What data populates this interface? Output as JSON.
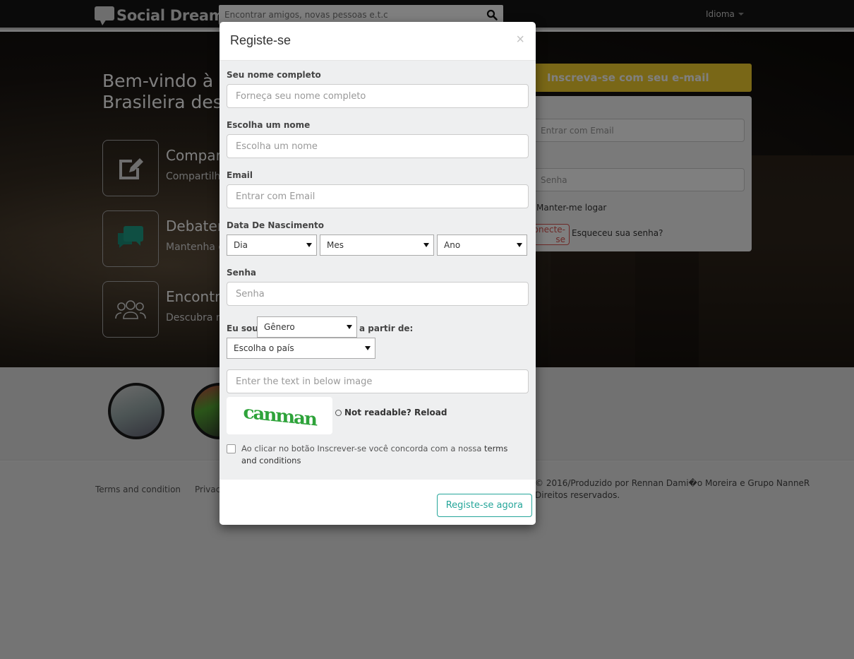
{
  "navbar": {
    "brand": "Social Dream",
    "search_placeholder": "Encontrar amigos, novas pessoas e.t.c",
    "language_label": "Idioma"
  },
  "hero": {
    "title_line1": "Bem-vindo à r",
    "title_line2": "Brasileira dese",
    "features": [
      {
        "icon": "edit-icon",
        "title": "Compart",
        "desc": "Compartilhe"
      },
      {
        "icon": "chat-bubbles-icon",
        "title": "Debater",
        "desc": "Mantenha c"
      },
      {
        "icon": "users-icon",
        "title": "Encontre",
        "desc": "Descubra no"
      }
    ]
  },
  "login": {
    "header": "Inscreva-se com seu e-mail",
    "email_placeholder": "Entrar com Email",
    "password_placeholder": "Senha",
    "remember_label": "Manter-me logar",
    "login_button": "Conecte-se",
    "forgot_link": "Esqueceu sua senha?"
  },
  "footer": {
    "links": [
      "Terms and condition",
      "Privacy"
    ],
    "copyright_line1": "© 2016/Produzido por Rennan Dami�o Moreira e Grupo NanneR",
    "copyright_line2": "Direitos reservados."
  },
  "modal": {
    "title": "Registe-se",
    "close": "×",
    "fields": {
      "fullname": {
        "label": "Seu nome completo",
        "placeholder": "Forneça seu nome completo",
        "value": ""
      },
      "username": {
        "label": "Escolha um nome",
        "placeholder": "Escolha um nome",
        "value": ""
      },
      "email": {
        "label": "Email",
        "placeholder": "Entrar com Email",
        "value": ""
      },
      "birthdate": {
        "label": "Data De Nascimento",
        "day": "Dia",
        "month": "Mes",
        "year": "Ano"
      },
      "password": {
        "label": "Senha",
        "placeholder": "Senha",
        "value": ""
      },
      "gender": {
        "label": "Eu sou:",
        "selected": "Gênero"
      },
      "country": {
        "label": "a partir de:",
        "selected": "Escolha o país"
      },
      "captcha": {
        "placeholder": "Enter the text in below image",
        "image_text": "canman",
        "reload_label": "Not readable? Reload"
      }
    },
    "terms": {
      "checked": false,
      "text": "Ao clicar no botão Inscrever-se você concorda com a nossa",
      "link": "terms and conditions"
    },
    "submit_label": "Registe-se agora"
  }
}
